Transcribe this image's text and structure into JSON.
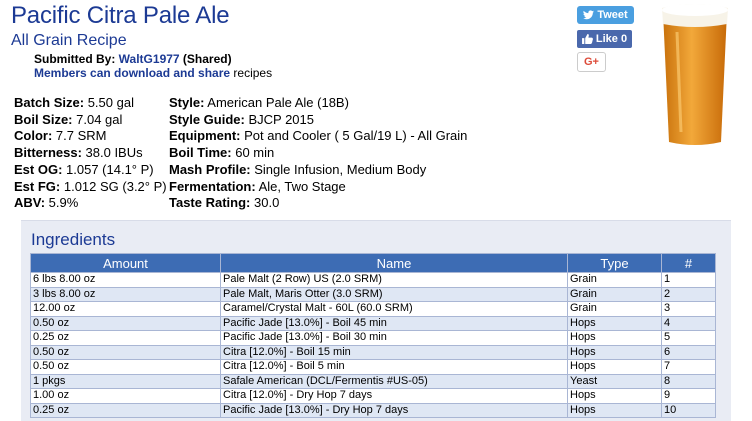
{
  "recipe": {
    "title": "Pacific Citra Pale Ale",
    "subtitle": "All Grain Recipe",
    "submitted_label": "Submitted By: ",
    "submitter": "WaltG1977",
    "shared": " (Shared)",
    "members_link": "Members can download and share",
    "members_suffix": " recipes"
  },
  "social": {
    "tweet": "Tweet",
    "like": "Like 0",
    "gplus": "G+"
  },
  "stats_left": [
    {
      "label": "Batch Size:",
      "value": " 5.50 gal"
    },
    {
      "label": "Boil Size:",
      "value": " 7.04 gal"
    },
    {
      "label": "Color:",
      "value": " 7.7 SRM"
    },
    {
      "label": "Bitterness:",
      "value": " 38.0 IBUs"
    },
    {
      "label": "Est OG:",
      "value": " 1.057 (14.1° P)"
    },
    {
      "label": "Est FG:",
      "value": " 1.012 SG (3.2° P)"
    },
    {
      "label": "ABV:",
      "value": " 5.9%"
    }
  ],
  "stats_right": [
    {
      "label": "Style:",
      "value": " American Pale Ale (18B)"
    },
    {
      "label": "Style Guide:",
      "value": " BJCP 2015"
    },
    {
      "label": "Equipment:",
      "value": " Pot and Cooler ( 5 Gal/19 L) - All Grain"
    },
    {
      "label": "Boil Time:",
      "value": " 60 min"
    },
    {
      "label": "Mash Profile:",
      "value": " Single Infusion, Medium Body"
    },
    {
      "label": "Fermentation:",
      "value": " Ale, Two Stage"
    },
    {
      "label": "Taste Rating:",
      "value": " 30.0"
    }
  ],
  "ingredients": {
    "title": "Ingredients",
    "columns": [
      "Amount",
      "Name",
      "Type",
      "#"
    ],
    "rows": [
      [
        "6 lbs 8.00 oz",
        "Pale Malt (2 Row) US (2.0 SRM)",
        "Grain",
        "1"
      ],
      [
        "3 lbs 8.00 oz",
        "Pale Malt, Maris Otter (3.0 SRM)",
        "Grain",
        "2"
      ],
      [
        "12.00 oz",
        "Caramel/Crystal Malt - 60L (60.0 SRM)",
        "Grain",
        "3"
      ],
      [
        "0.50 oz",
        "Pacific Jade [13.0%] - Boil 45 min",
        "Hops",
        "4"
      ],
      [
        "0.25 oz",
        "Pacific Jade [13.0%] - Boil 30 min",
        "Hops",
        "5"
      ],
      [
        "0.50 oz",
        "Citra [12.0%] - Boil 15 min",
        "Hops",
        "6"
      ],
      [
        "0.50 oz",
        "Citra [12.0%] - Boil 5 min",
        "Hops",
        "7"
      ],
      [
        "1 pkgs",
        "Safale American (DCL/Fermentis #US-05)",
        "Yeast",
        "8"
      ],
      [
        "1.00 oz",
        "Citra [12.0%] - Dry Hop 7 days",
        "Hops",
        "9"
      ],
      [
        "0.25 oz",
        "Pacific Jade [13.0%] - Dry Hop 7 days",
        "Hops",
        "10"
      ]
    ]
  },
  "colors": {
    "brand_blue": "#1c3a94",
    "table_header": "#3d6cb4",
    "twitter": "#4a9fe0",
    "facebook": "#4a68ac",
    "gplus": "#dd4b39"
  },
  "icons": [
    "twitter-bird-icon",
    "thumbs-up-icon",
    "beer-glass-image"
  ]
}
